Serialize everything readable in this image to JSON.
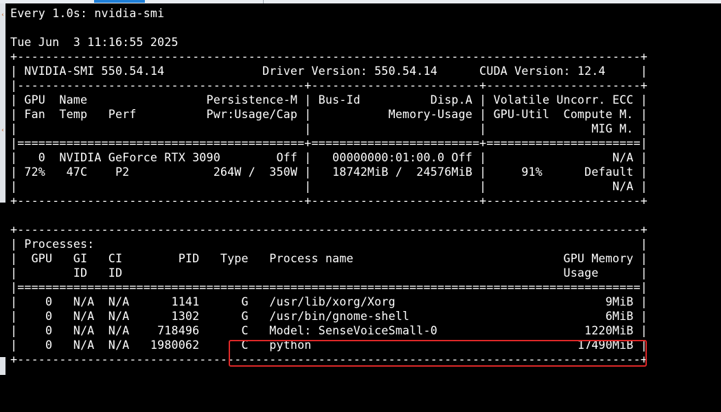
{
  "watch_header": "Every 1.0s: nvidia-smi",
  "timestamp": "Tue Jun  3 11:16:55 2025",
  "smi": {
    "border": "+-----------------------------------------------------------------------------------------+",
    "version_row": "| NVIDIA-SMI 550.54.14              Driver Version: 550.54.14      CUDA Version: 12.4     |",
    "gpu_sep": "|-----------------------------------------+------------------------+----------------------+",
    "gpu_header_1": "| GPU  Name                 Persistence-M | Bus-Id          Disp.A | Volatile Uncorr. ECC |",
    "gpu_header_2": "| Fan  Temp   Perf          Pwr:Usage/Cap |           Memory-Usage | GPU-Util  Compute M. |",
    "gpu_header_3": "|                                         |                        |               MIG M. |",
    "gpu_double": "|=========================================+========================+======================|",
    "gpu_row_1": "|   0  NVIDIA GeForce RTX 3090        Off |   00000000:01:00.0 Off |                  N/A |",
    "gpu_row_2": "| 72%   47C    P2            264W /  350W |   18742MiB /  24576MiB |     91%      Default |",
    "gpu_row_3": "|                                         |                        |                  N/A |",
    "gpu_bottom": "+-----------------------------------------+------------------------+----------------------+",
    "proc_title": "| Processes:                                                                              |",
    "proc_header_1": "|  GPU   GI   CI        PID   Type   Process name                              GPU Memory |",
    "proc_header_2": "|        ID   ID                                                               Usage      |",
    "proc_double": "|=========================================================================================|"
  },
  "processes": [
    {
      "gpu": "0",
      "gi": "N/A",
      "ci": "N/A",
      "pid": "1141",
      "type": "G",
      "name": "/usr/lib/xorg/Xorg",
      "memory": "9MiB",
      "line": "|    0   N/A  N/A      1141      G   /usr/lib/xorg/Xorg                              9MiB |"
    },
    {
      "gpu": "0",
      "gi": "N/A",
      "ci": "N/A",
      "pid": "1302",
      "type": "G",
      "name": "/usr/bin/gnome-shell",
      "memory": "6MiB",
      "line": "|    0   N/A  N/A      1302      G   /usr/bin/gnome-shell                            6MiB |"
    },
    {
      "gpu": "0",
      "gi": "N/A",
      "ci": "N/A",
      "pid": "718496",
      "type": "C",
      "name": "Model: SenseVoiceSmall-0",
      "memory": "1220MiB",
      "line": "|    0   N/A  N/A    718496      C   Model: SenseVoiceSmall-0                     1220MiB |"
    },
    {
      "gpu": "0",
      "gi": "N/A",
      "ci": "N/A",
      "pid": "1980062",
      "type": "C",
      "name": "python",
      "memory": "17490MiB",
      "line": "|    0   N/A  N/A   1980062      C   python                                      17490MiB |"
    }
  ],
  "colors": {
    "terminal_bg": "#000000",
    "terminal_fg": "#ffffff",
    "highlight": "#e02828"
  }
}
